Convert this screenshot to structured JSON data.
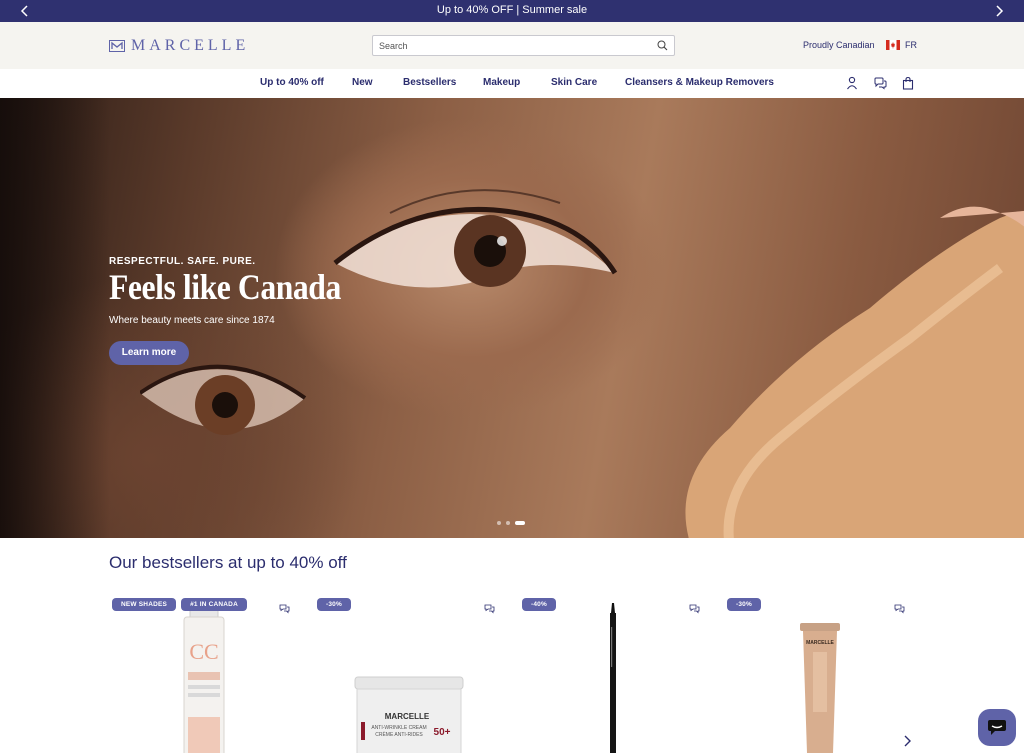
{
  "promo": {
    "message": "Up to 40% OFF | Summer sale"
  },
  "header": {
    "logo_text": "MARCELLE",
    "search_placeholder": "Search",
    "proudly": "Proudly Canadian",
    "lang": "FR"
  },
  "nav": {
    "items": [
      "Up to 40% off",
      "New",
      "Bestsellers",
      "Makeup",
      "Skin Care",
      "Cleansers & Makeup Removers"
    ]
  },
  "hero": {
    "eyebrow": "RESPECTFUL. SAFE. PURE.",
    "title": "Feels like Canada",
    "subtitle": "Where beauty meets care since 1874",
    "cta": "Learn more",
    "slides": 3,
    "active_slide": 3
  },
  "bestsellers": {
    "title": "Our bestsellers at up to 40% off",
    "products": [
      {
        "badges": [
          "NEW SHADES",
          "#1 IN CANADA"
        ],
        "image": "cc-cream-bottle",
        "label_text": "CC"
      },
      {
        "badges": [
          "-30%"
        ],
        "image": "anti-wrinkle-cream-jar",
        "label_text": "MARCELLE",
        "label_sub": "ANTI-WRINKLE CREAM",
        "label_sub2": "CRÈME ANTI-RIDES",
        "spf": "50+"
      },
      {
        "badges": [
          "-40%"
        ],
        "image": "eyeliner-pencil"
      },
      {
        "badges": [
          "-30%"
        ],
        "image": "concealer-tube",
        "label_text": "MARCELLE"
      }
    ]
  },
  "colors": {
    "navy": "#2f3170",
    "accent": "#5f63a8",
    "text": "#2b2d6e",
    "header_bg": "#f5f4f0"
  }
}
